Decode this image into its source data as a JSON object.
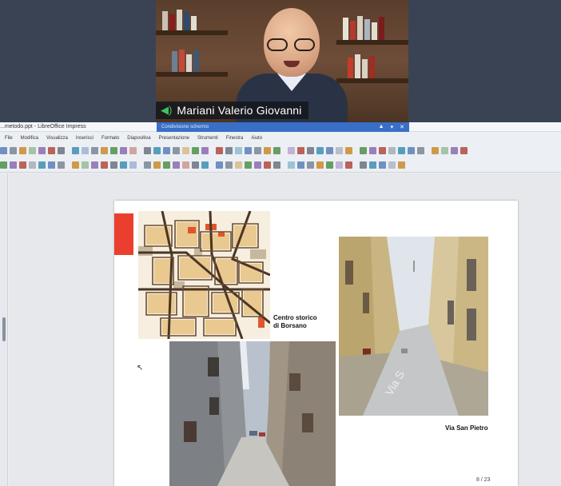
{
  "video": {
    "participant_name": "Mariani Valerio Giovanni",
    "mic_icon": "speaker-on-icon"
  },
  "app": {
    "window_title": "...metodo.ppt - LibreOffice Impress",
    "share_bar_label": "Condivisione schermo",
    "share_controls": [
      "▲",
      "▾",
      "✕"
    ],
    "menu": [
      "File",
      "Modifica",
      "Visualizza",
      "Inserisci",
      "Formato",
      "Diapositiva",
      "Presentazione",
      "Strumenti",
      "Finestra",
      "Aiuto"
    ]
  },
  "slide": {
    "caption_centro_line1": "Centro storico",
    "caption_centro_line2": "di Borsano",
    "caption_via": "Via San Pietro",
    "page_counter": "8 / 23",
    "accent_color": "#ea3f2e"
  },
  "colors": {
    "background": "#3a4354",
    "share_bar": "#3a6fc7",
    "name_tag_icon": "#3ac45f"
  }
}
